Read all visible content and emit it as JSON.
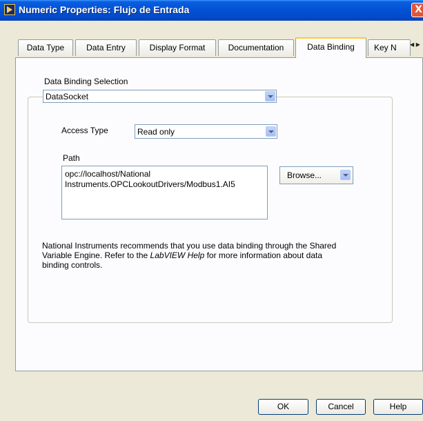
{
  "window": {
    "title": "Numeric Properties: Flujo de Entrada",
    "close_label": "X"
  },
  "tabs": [
    {
      "label": "Data Type"
    },
    {
      "label": "Data Entry"
    },
    {
      "label": "Display Format"
    },
    {
      "label": "Documentation"
    },
    {
      "label": "Data Binding",
      "active": true
    },
    {
      "label": "Key N"
    }
  ],
  "tab_scroll": {
    "left": "◀",
    "right": "▶"
  },
  "binding": {
    "selection_label": "Data Binding Selection",
    "selection_value": "DataSocket",
    "access_type_label": "Access Type",
    "access_type_value": "Read only",
    "path_label": "Path",
    "path_line1": "opc://localhost/National",
    "path_line2": "Instruments.OPCLookoutDrivers/Modbus1.AI5",
    "browse_label": "Browse..."
  },
  "info": {
    "line1": "National Instruments recommends that you use data binding through the Shared",
    "line2_before": "Variable Engine.  Refer to the ",
    "line2_italic": "LabVIEW Help",
    "line2_after": " for more information about data",
    "line3": "binding controls."
  },
  "buttons": {
    "ok": "OK",
    "cancel": "Cancel",
    "help": "Help"
  },
  "colors": {
    "title_bar": "#0553d6",
    "active_tab_accent": "#ffc83c",
    "dialog_bg": "#ece9d8"
  }
}
